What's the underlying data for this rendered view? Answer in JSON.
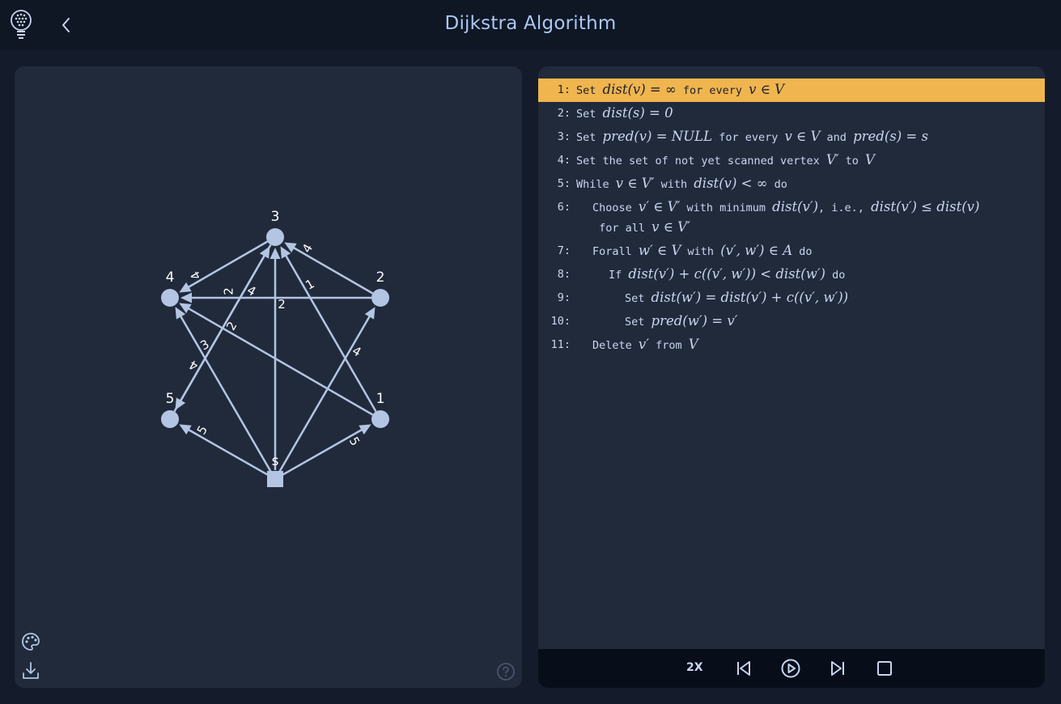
{
  "app": {
    "title": "Dijkstra Algorithm"
  },
  "icons": {
    "logo": "lightbulb-icon",
    "back": "chevron-left-icon",
    "palette": "palette-icon",
    "download": "download-icon",
    "help": "help-circle-icon",
    "prev": "skip-back-icon",
    "play": "play-icon",
    "next": "skip-forward-icon",
    "stop": "stop-icon"
  },
  "colors": {
    "background": "#141c2b",
    "panel": "#212a3b",
    "node": "#b3c5e2",
    "highlight": "#f0b54e",
    "title": "#aac8f2"
  },
  "graph": {
    "nodes": [
      {
        "id": "s",
        "label": "s",
        "shape": "square"
      },
      {
        "id": "1",
        "label": "1",
        "shape": "circle"
      },
      {
        "id": "2",
        "label": "2",
        "shape": "circle"
      },
      {
        "id": "3",
        "label": "3",
        "shape": "circle"
      },
      {
        "id": "4",
        "label": "4",
        "shape": "circle"
      },
      {
        "id": "5",
        "label": "5",
        "shape": "circle"
      }
    ],
    "edges": [
      {
        "from": "s",
        "to": "1",
        "weight": "5"
      },
      {
        "from": "s",
        "to": "5",
        "weight": "5"
      },
      {
        "from": "s",
        "to": "2",
        "weight": "4"
      },
      {
        "from": "s",
        "to": "3",
        "weight": "2"
      },
      {
        "from": "s",
        "to": "4",
        "weight": "3"
      },
      {
        "from": "5",
        "to": "3",
        "weight": "4"
      },
      {
        "from": "3",
        "to": "5",
        "weight": "4"
      },
      {
        "from": "1",
        "to": "3",
        "weight": "1"
      },
      {
        "from": "1",
        "to": "4",
        "weight": "2"
      },
      {
        "from": "2",
        "to": "4",
        "weight": "2"
      },
      {
        "from": "2",
        "to": "3",
        "weight": "4"
      },
      {
        "from": "3",
        "to": "4",
        "weight": "4"
      }
    ]
  },
  "algorithm": {
    "active_line": 1,
    "lines": [
      {
        "num": "1:",
        "parts": [
          {
            "t": "Set "
          },
          {
            "m": "dist(v) = ∞"
          },
          {
            "t": " for every "
          },
          {
            "m": "v ∈ V"
          }
        ]
      },
      {
        "num": "2:",
        "parts": [
          {
            "t": "Set "
          },
          {
            "m": "dist(s) = 0"
          }
        ]
      },
      {
        "num": "3:",
        "parts": [
          {
            "t": "Set "
          },
          {
            "m": "pred(v) = NULL"
          },
          {
            "t": " for every "
          },
          {
            "m": "v ∈ V"
          },
          {
            "t": " and "
          },
          {
            "m": "pred(s) = s"
          }
        ]
      },
      {
        "num": "4:",
        "parts": [
          {
            "t": "Set the set of not yet scanned vertex "
          },
          {
            "m": "V′"
          },
          {
            "t": " to "
          },
          {
            "m": "V"
          }
        ]
      },
      {
        "num": "5:",
        "parts": [
          {
            "t": "While "
          },
          {
            "m": "v ∈ V′"
          },
          {
            "t": " with "
          },
          {
            "m": "dist(v) < ∞"
          },
          {
            "t": " do"
          }
        ]
      },
      {
        "num": "6:",
        "indent": 1,
        "wrap": true,
        "parts": [
          {
            "t": "Choose "
          },
          {
            "m": "v′ ∈ V′"
          },
          {
            "t": " with minimum "
          },
          {
            "m": "dist(v′)"
          },
          {
            "t": ", i.e., "
          },
          {
            "m": "dist(v′) ≤ dist(v)"
          },
          {
            "t": " for all "
          },
          {
            "m": "v ∈ V′"
          }
        ]
      },
      {
        "num": "7:",
        "indent": 1,
        "parts": [
          {
            "t": "Forall "
          },
          {
            "m": "w′ ∈ V"
          },
          {
            "t": " with "
          },
          {
            "m": "(v′, w′) ∈ A"
          },
          {
            "t": " do"
          }
        ]
      },
      {
        "num": "8:",
        "indent": 2,
        "parts": [
          {
            "t": "If "
          },
          {
            "m": "dist(v′) + c((v′, w′)) < dist(w′)"
          },
          {
            "t": " do"
          }
        ]
      },
      {
        "num": "9:",
        "indent": 3,
        "parts": [
          {
            "t": "Set "
          },
          {
            "m": "dist(w′) = dist(v′) + c((v′, w′))"
          }
        ]
      },
      {
        "num": "10:",
        "indent": 3,
        "parts": [
          {
            "t": "Set "
          },
          {
            "m": "pred(w′) = v′"
          }
        ]
      },
      {
        "num": "11:",
        "indent": 1,
        "parts": [
          {
            "t": "Delete "
          },
          {
            "m": "v′"
          },
          {
            "t": " from "
          },
          {
            "m": "V"
          }
        ]
      }
    ]
  },
  "controls": {
    "speed": "2X"
  }
}
